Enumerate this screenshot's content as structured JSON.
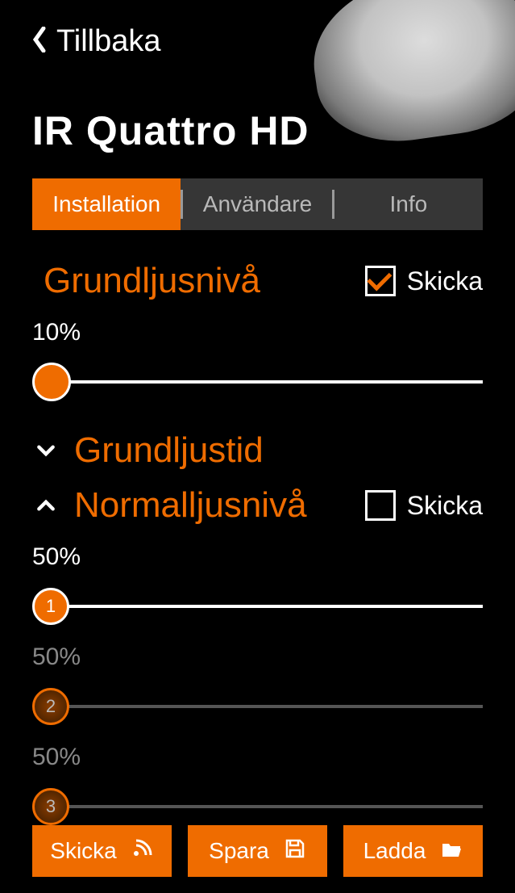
{
  "nav": {
    "back_label": "Tillbaka"
  },
  "product": {
    "title": "IR Quattro HD"
  },
  "tabs": {
    "installation": "Installation",
    "user": "Användare",
    "info": "Info",
    "active": "installation"
  },
  "sections": {
    "basic_light_level": {
      "title": "Grundljusnivå",
      "send_label": "Skicka",
      "send_checked": true,
      "slider": {
        "value_text": "10%",
        "value": 10
      }
    },
    "basic_light_time": {
      "title": "Grundljustid",
      "expanded": false
    },
    "normal_light_level": {
      "title": "Normalljusnivå",
      "send_label": "Skicka",
      "send_checked": false,
      "expanded": true,
      "sliders": [
        {
          "num": "1",
          "value_text": "50%",
          "value": 50,
          "active": true
        },
        {
          "num": "2",
          "value_text": "50%",
          "value": 50,
          "active": false
        },
        {
          "num": "3",
          "value_text": "50%",
          "value": 50,
          "active": false
        }
      ]
    }
  },
  "buttons": {
    "send": "Skicka",
    "save": "Spara",
    "load": "Ladda"
  }
}
